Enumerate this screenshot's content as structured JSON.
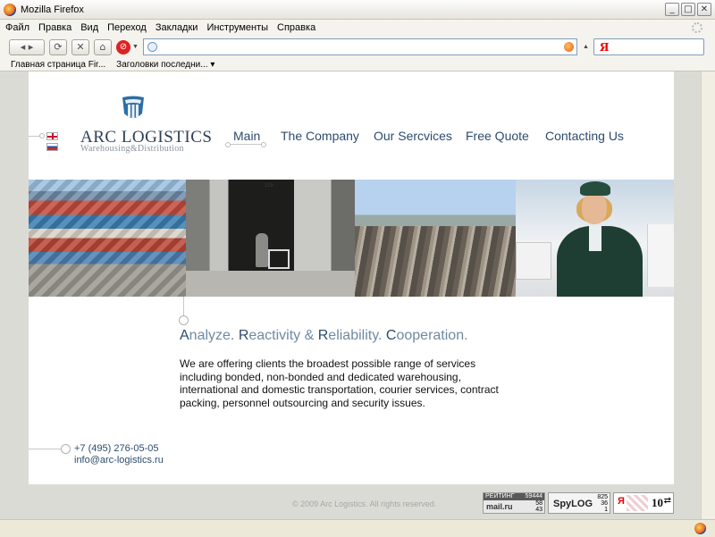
{
  "browser": {
    "title": "Mozilla Firefox",
    "menu": [
      "Файл",
      "Правка",
      "Вид",
      "Переход",
      "Закладки",
      "Инструменты",
      "Справка"
    ],
    "url": "",
    "search_engine_icon": "Я",
    "bookmarks": [
      "Главная страница Fir...",
      "Заголовки последни..."
    ]
  },
  "site": {
    "logo": {
      "name": "ARC LOGISTICS",
      "tagline": "Warehousing&Distribution"
    },
    "languages": [
      "en",
      "ru"
    ],
    "nav": [
      {
        "label": "Main",
        "active": true
      },
      {
        "label": "The Company",
        "active": false
      },
      {
        "label": "Our Sercvices",
        "active": false
      },
      {
        "label": "Free Quote",
        "active": false
      },
      {
        "label": "Contacting Us",
        "active": false
      }
    ],
    "photo_number": "115",
    "slogan": [
      {
        "cap": "A",
        "rest": "nalyze. "
      },
      {
        "cap": "R",
        "rest": "eactivity & "
      },
      {
        "cap": "R",
        "rest": "eliability. "
      },
      {
        "cap": "C",
        "rest": "ooperation."
      }
    ],
    "intro": "We are offering clients the broadest possible range of services including bonded, non-bonded and dedicated warehousing, international and domestic transportation, courier services, contract packing, personnel outsourcing and security issues.",
    "contact": {
      "phone": "+7 (495) 276-05-05",
      "email": "info@arc-logistics.ru"
    },
    "copyright": "© 2009 Arc Logistics. All rights reserved."
  },
  "counters": {
    "mail": {
      "label": "РЕЙТИНГ",
      "total": "59444",
      "logo": "mail.ru",
      "a": "58",
      "b": "43"
    },
    "spylog": {
      "logo": "SpyLOG",
      "a": "825",
      "b": "36",
      "c": "1"
    },
    "yandex": {
      "y": "Я",
      "value": "10",
      "arrow": "⇄"
    }
  },
  "colors": {
    "nav": "#2c4b6e",
    "slogan_cap": "#2a4c6e",
    "slogan_rest": "#6f8aa3",
    "page_bg": "#dbdbd6"
  }
}
